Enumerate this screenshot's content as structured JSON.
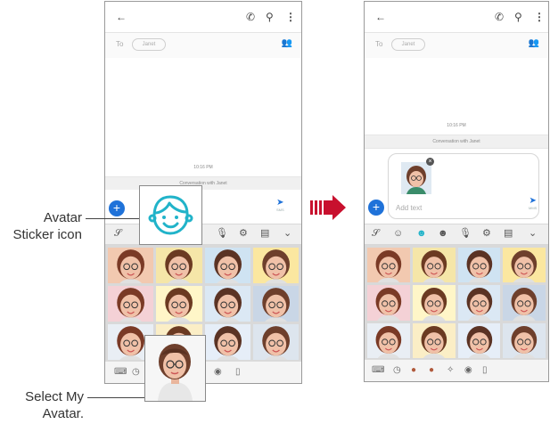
{
  "annotations": {
    "avatar_sticker": {
      "line1": "Avatar",
      "line2": "Sticker icon"
    },
    "select_avatar": {
      "line1": "Select My",
      "line2": "Avatar."
    }
  },
  "phone_before": {
    "to_label": "To",
    "recipient": "Janet",
    "time": "10:16 PM",
    "conversation": "Conversation with Janet",
    "send_label": "SMS"
  },
  "phone_after": {
    "to_label": "To",
    "recipient": "Janet",
    "time": "10:16 PM",
    "conversation": "Conversation with Janet",
    "input_placeholder": "Add text",
    "send_label": "MMS"
  },
  "colors": {
    "accent": "#1f72d9",
    "arrow": "#c8102e",
    "sticker_outline": "#21b3c9"
  },
  "icons": [
    "back-arrow-icon",
    "phone-icon",
    "search-icon",
    "more-icon",
    "add-contact-icon",
    "plus-icon",
    "send-icon",
    "handwriting-icon",
    "emoji-icon",
    "avatar-sticker-icon",
    "sticker-icon",
    "mic-icon",
    "settings-icon",
    "clipboard-icon",
    "chevron-down-icon",
    "keyboard-icon",
    "recent-icon"
  ]
}
